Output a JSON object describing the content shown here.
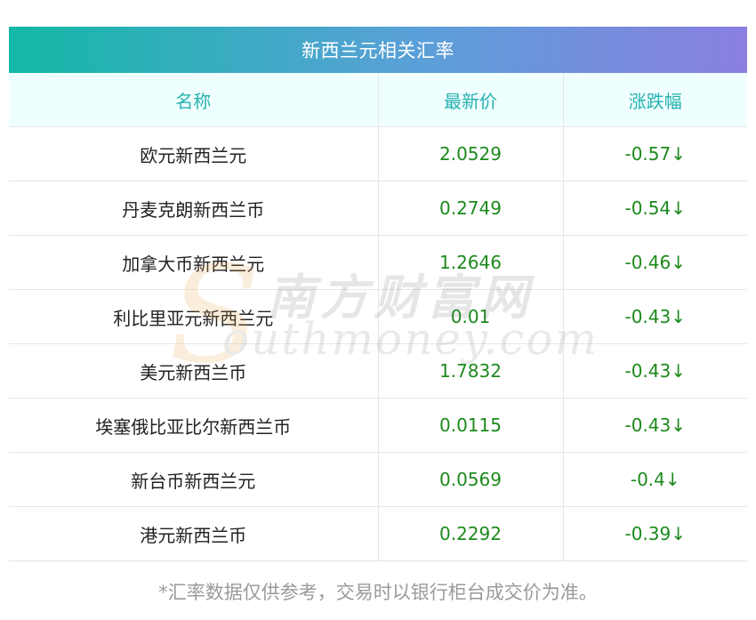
{
  "title": "新西兰元相关汇率",
  "columns": [
    "名称",
    "最新价",
    "涨跌幅"
  ],
  "rows": [
    {
      "name": "欧元新西兰元",
      "price": "2.0529",
      "change": "-0.57↓"
    },
    {
      "name": "丹麦克朗新西兰币",
      "price": "0.2749",
      "change": "-0.54↓"
    },
    {
      "name": "加拿大币新西兰元",
      "price": "1.2646",
      "change": "-0.46↓"
    },
    {
      "name": "利比里亚元新西兰元",
      "price": "0.01",
      "change": "-0.43↓"
    },
    {
      "name": "美元新西兰币",
      "price": "1.7832",
      "change": "-0.43↓"
    },
    {
      "name": "埃塞俄比亚比尔新西兰币",
      "price": "0.0115",
      "change": "-0.43↓"
    },
    {
      "name": "新台币新西兰元",
      "price": "0.0569",
      "change": "-0.4↓"
    },
    {
      "name": "港元新西兰币",
      "price": "0.2292",
      "change": "-0.39↓"
    }
  ],
  "footnote": "*汇率数据仅供参考，交易时以银行柜台成交价为准。",
  "watermark": {
    "cn": "南方财富网",
    "en": "outhmoney.com",
    "s": "S"
  },
  "colors": {
    "header_gradient_start": "#14b8a6",
    "header_gradient_end": "#8a7fe0",
    "column_header_text": "#26b3b0",
    "value_text": "#1c8a1c"
  }
}
